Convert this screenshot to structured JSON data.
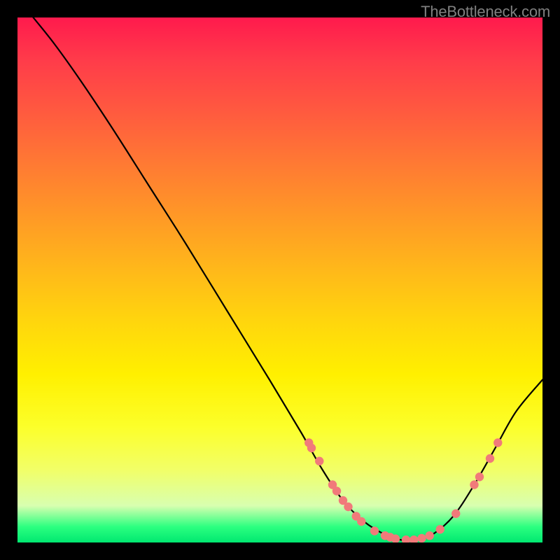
{
  "watermark": "TheBottleneck.com",
  "chart_data": {
    "type": "line",
    "title": "",
    "xlabel": "",
    "ylabel": "",
    "xlim": [
      0,
      100
    ],
    "ylim": [
      0,
      100
    ],
    "curve": [
      {
        "x": 3,
        "y": 100
      },
      {
        "x": 7,
        "y": 95
      },
      {
        "x": 12,
        "y": 88
      },
      {
        "x": 18,
        "y": 79
      },
      {
        "x": 25,
        "y": 68
      },
      {
        "x": 32,
        "y": 57
      },
      {
        "x": 40,
        "y": 44
      },
      {
        "x": 48,
        "y": 31
      },
      {
        "x": 54,
        "y": 21
      },
      {
        "x": 58,
        "y": 14
      },
      {
        "x": 62,
        "y": 8
      },
      {
        "x": 66,
        "y": 4
      },
      {
        "x": 70,
        "y": 1.5
      },
      {
        "x": 73,
        "y": 0.5
      },
      {
        "x": 76,
        "y": 0.5
      },
      {
        "x": 79,
        "y": 1.5
      },
      {
        "x": 83,
        "y": 5
      },
      {
        "x": 87,
        "y": 11
      },
      {
        "x": 91,
        "y": 18
      },
      {
        "x": 95,
        "y": 25
      },
      {
        "x": 100,
        "y": 31
      }
    ],
    "markers": [
      {
        "x": 55.5,
        "y": 19
      },
      {
        "x": 56,
        "y": 18
      },
      {
        "x": 57.5,
        "y": 15.5
      },
      {
        "x": 60,
        "y": 11
      },
      {
        "x": 60.8,
        "y": 9.8
      },
      {
        "x": 62,
        "y": 8
      },
      {
        "x": 63,
        "y": 6.8
      },
      {
        "x": 64.5,
        "y": 5
      },
      {
        "x": 65.5,
        "y": 4
      },
      {
        "x": 68,
        "y": 2.2
      },
      {
        "x": 70,
        "y": 1.3
      },
      {
        "x": 71,
        "y": 1
      },
      {
        "x": 72,
        "y": 0.7
      },
      {
        "x": 74,
        "y": 0.5
      },
      {
        "x": 75.5,
        "y": 0.5
      },
      {
        "x": 77,
        "y": 0.8
      },
      {
        "x": 78.5,
        "y": 1.3
      },
      {
        "x": 80.5,
        "y": 2.5
      },
      {
        "x": 83.5,
        "y": 5.5
      },
      {
        "x": 87,
        "y": 11
      },
      {
        "x": 88,
        "y": 12.5
      },
      {
        "x": 90,
        "y": 16
      },
      {
        "x": 91.5,
        "y": 19
      }
    ],
    "color_gradient": {
      "top": "#ff1a4d",
      "mid": "#fff000",
      "bottom": "#00e870"
    },
    "curve_stroke": "#000000",
    "marker_fill": "#f17a7a"
  }
}
